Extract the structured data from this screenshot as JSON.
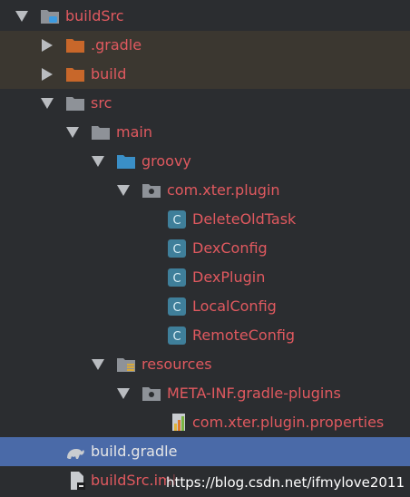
{
  "tree": {
    "items": [
      {
        "label": "buildSrc",
        "icon": "module-folder-icon"
      },
      {
        "label": ".gradle",
        "icon": "excluded-folder-icon"
      },
      {
        "label": "build",
        "icon": "excluded-folder-icon"
      },
      {
        "label": "src",
        "icon": "folder-icon"
      },
      {
        "label": "main",
        "icon": "folder-icon"
      },
      {
        "label": "groovy",
        "icon": "source-folder-icon"
      },
      {
        "label": "com.xter.plugin",
        "icon": "package-icon"
      },
      {
        "label": "DeleteOldTask",
        "icon": "class-icon"
      },
      {
        "label": "DexConfig",
        "icon": "class-icon"
      },
      {
        "label": "DexPlugin",
        "icon": "class-icon"
      },
      {
        "label": "LocalConfig",
        "icon": "class-icon"
      },
      {
        "label": "RemoteConfig",
        "icon": "class-icon"
      },
      {
        "label": "resources",
        "icon": "resources-folder-icon"
      },
      {
        "label": "META-INF.gradle-plugins",
        "icon": "package-icon"
      },
      {
        "label": "com.xter.plugin.properties",
        "icon": "properties-file-icon"
      },
      {
        "label": "build.gradle",
        "icon": "gradle-icon"
      },
      {
        "label": "buildSrc.iml",
        "icon": "iml-file-icon"
      }
    ]
  },
  "watermark": "https://blog.csdn.net/ifmylove2011",
  "colors": {
    "background": "#2b2d30",
    "selection": "#4a6aa8",
    "excluded_row": "#3b3730",
    "label_modified": "#e0595f",
    "label_default": "#e6e6e6"
  }
}
